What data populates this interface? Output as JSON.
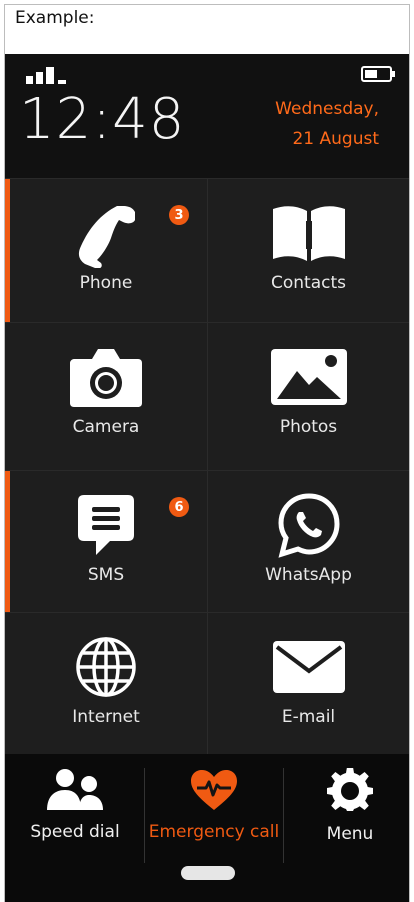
{
  "caption": "Example:",
  "status": {
    "time": "12:48",
    "day": "Wednesday,",
    "date": "21 August"
  },
  "tiles": [
    {
      "label": "Phone",
      "icon": "phone-icon",
      "badge": "3"
    },
    {
      "label": "Contacts",
      "icon": "contacts-book-icon"
    },
    {
      "label": "Camera",
      "icon": "camera-icon"
    },
    {
      "label": "Photos",
      "icon": "photos-icon"
    },
    {
      "label": "SMS",
      "icon": "sms-bubble-icon",
      "badge": "6"
    },
    {
      "label": "WhatsApp",
      "icon": "whatsapp-icon"
    },
    {
      "label": "Internet",
      "icon": "globe-icon"
    },
    {
      "label": "E-mail",
      "icon": "envelope-icon"
    }
  ],
  "bottom_bar": {
    "speed_dial": "Speed dial",
    "emergency": "Emergency call",
    "menu": "Menu"
  },
  "colors": {
    "accent": "#f05a12",
    "date_text": "#ff6a1a",
    "tile_bg": "#1e1e1e",
    "background": "#141414"
  }
}
